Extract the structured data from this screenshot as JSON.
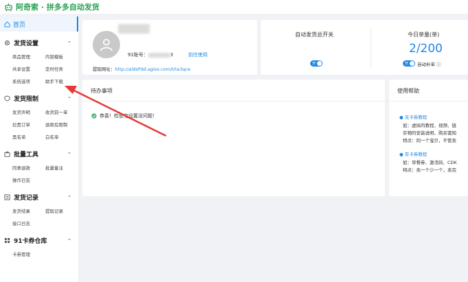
{
  "header": {
    "brand": "阿奇索 · 拼多多自动发货",
    "logo_icon": "robot-logo-icon"
  },
  "sidebar": {
    "home": "首页",
    "sections": [
      {
        "title": "发货设置",
        "icon": "gear-icon",
        "items": [
          "商品管理",
          "内容模板",
          "共享设置",
          "定时任务",
          "系统选项",
          "助手下载"
        ]
      },
      {
        "title": "发货限制",
        "icon": "shield-icon",
        "items": [
          "发货声明",
          "收货前一单",
          "拉黑订单",
          "退款后限制",
          "黑名单",
          "白名单"
        ]
      },
      {
        "title": "批量工具",
        "icon": "briefcase-icon",
        "items": [
          "同意退款",
          "批量备注",
          "操作日志"
        ]
      },
      {
        "title": "发货记录",
        "icon": "list-icon",
        "items": [
          "发货结果",
          "提取记录",
          "接口日志"
        ]
      },
      {
        "title": "91卡券仓库",
        "icon": "grid-icon",
        "items": [
          "卡券管理"
        ]
      }
    ]
  },
  "profile": {
    "account_label": "91账号：",
    "account_suffix": "3",
    "use_link": "前往使用",
    "fetch_label": "提取网址：",
    "fetch_url": "http://aldsPdd.agiso.com/t/ta3qce"
  },
  "stats": {
    "auto_ship_label": "自动发货总开关",
    "auto_ship_toggle": "开",
    "today_label": "今日单量(单)",
    "today_value": "2/200",
    "auto_refill_toggle": "开",
    "auto_refill_label": "自动补单"
  },
  "todo": {
    "title": "待办事项",
    "message": "恭喜！检查完设置没问题！"
  },
  "help": {
    "title": "使用帮助",
    "link1": "无卡券教程",
    "text1a": "如：虚拟的教程、视频、链",
    "text1b": "实物的安装说明、购买需知",
    "text1c": "特点：同一个宝贝，不管卖",
    "link2": "有卡券教程",
    "text2a": "如：早餐券、激活码、CDK",
    "text2b": "特点：卖一个少一个，卖完"
  },
  "colors": {
    "accent": "#1e88e5",
    "brand": "#2aa156",
    "arrow": "#e53935"
  }
}
